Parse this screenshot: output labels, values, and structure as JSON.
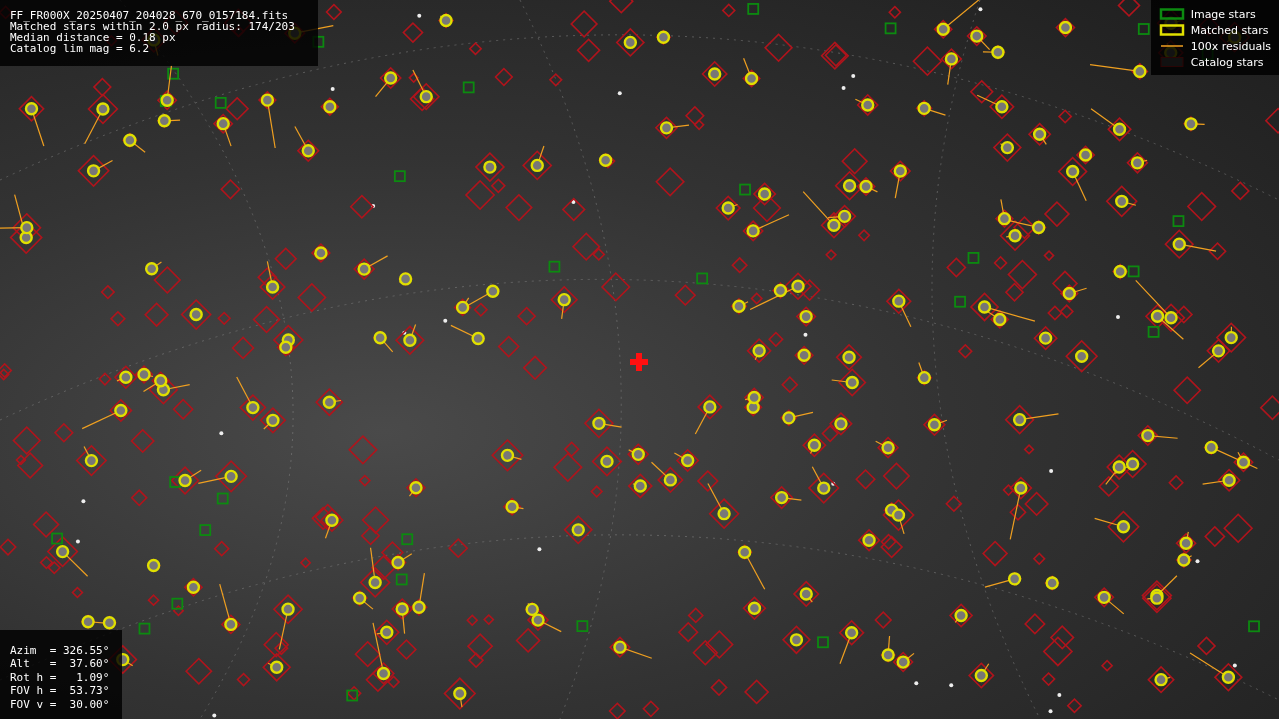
{
  "info_lines": [
    "FF_FR000X_20250407_204028_670_0157184.fits",
    "Matched stars within 2.0 px radius: 174/203",
    "Median distance = 0.18 px",
    "Catalog lim mag = 6.2"
  ],
  "legend": [
    {
      "kind": "image",
      "label": "Image stars"
    },
    {
      "kind": "matched",
      "label": "Matched stars"
    },
    {
      "kind": "residual",
      "label": "100x residuals"
    },
    {
      "kind": "catalog",
      "label": "Catalog stars"
    }
  ],
  "pointing": [
    "Azim  = 326.55°",
    "Alt   =  37.60°",
    "Rot h =   1.09°",
    "FOV h =  53.73°",
    "FOV v =  30.00°"
  ]
}
